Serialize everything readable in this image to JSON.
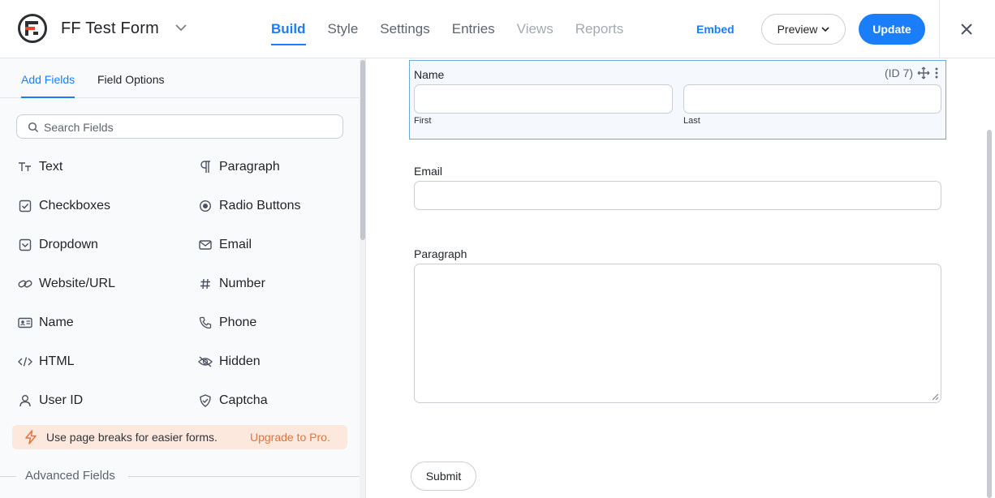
{
  "header": {
    "form_title": "FF Test Form",
    "tabs": [
      {
        "label": "Build",
        "state": "active"
      },
      {
        "label": "Style",
        "state": "normal"
      },
      {
        "label": "Settings",
        "state": "normal"
      },
      {
        "label": "Entries",
        "state": "normal"
      },
      {
        "label": "Views",
        "state": "disabled"
      },
      {
        "label": "Reports",
        "state": "disabled"
      }
    ],
    "embed_label": "Embed",
    "preview_label": "Preview",
    "update_label": "Update"
  },
  "sidebar": {
    "tabs": [
      {
        "label": "Add Fields",
        "state": "active"
      },
      {
        "label": "Field Options",
        "state": "normal"
      }
    ],
    "search_placeholder": "Search Fields",
    "fields": [
      {
        "label": "Text",
        "icon": "text-icon"
      },
      {
        "label": "Paragraph",
        "icon": "paragraph-icon"
      },
      {
        "label": "Checkboxes",
        "icon": "checkbox-icon"
      },
      {
        "label": "Radio Buttons",
        "icon": "radio-icon"
      },
      {
        "label": "Dropdown",
        "icon": "dropdown-icon"
      },
      {
        "label": "Email",
        "icon": "email-icon"
      },
      {
        "label": "Website/URL",
        "icon": "link-icon"
      },
      {
        "label": "Number",
        "icon": "hash-icon"
      },
      {
        "label": "Name",
        "icon": "id-card-icon"
      },
      {
        "label": "Phone",
        "icon": "phone-icon"
      },
      {
        "label": "HTML",
        "icon": "code-icon"
      },
      {
        "label": "Hidden",
        "icon": "eye-off-icon"
      },
      {
        "label": "User ID",
        "icon": "user-icon"
      },
      {
        "label": "Captcha",
        "icon": "shield-check-icon"
      }
    ],
    "promo": {
      "text": "Use page breaks for easier forms.",
      "link": "Upgrade to Pro."
    },
    "advanced_label": "Advanced Fields"
  },
  "form": {
    "name_field": {
      "label": "Name",
      "id_label": "(ID 7)",
      "first_sub": "First",
      "last_sub": "Last",
      "first_value": "",
      "last_value": ""
    },
    "email_field": {
      "label": "Email",
      "value": ""
    },
    "paragraph_field": {
      "label": "Paragraph",
      "value": ""
    },
    "submit_label": "Submit"
  },
  "colors": {
    "accent": "#1a7efb",
    "promo_bg": "#fde8de",
    "promo_link": "#e2733e"
  }
}
